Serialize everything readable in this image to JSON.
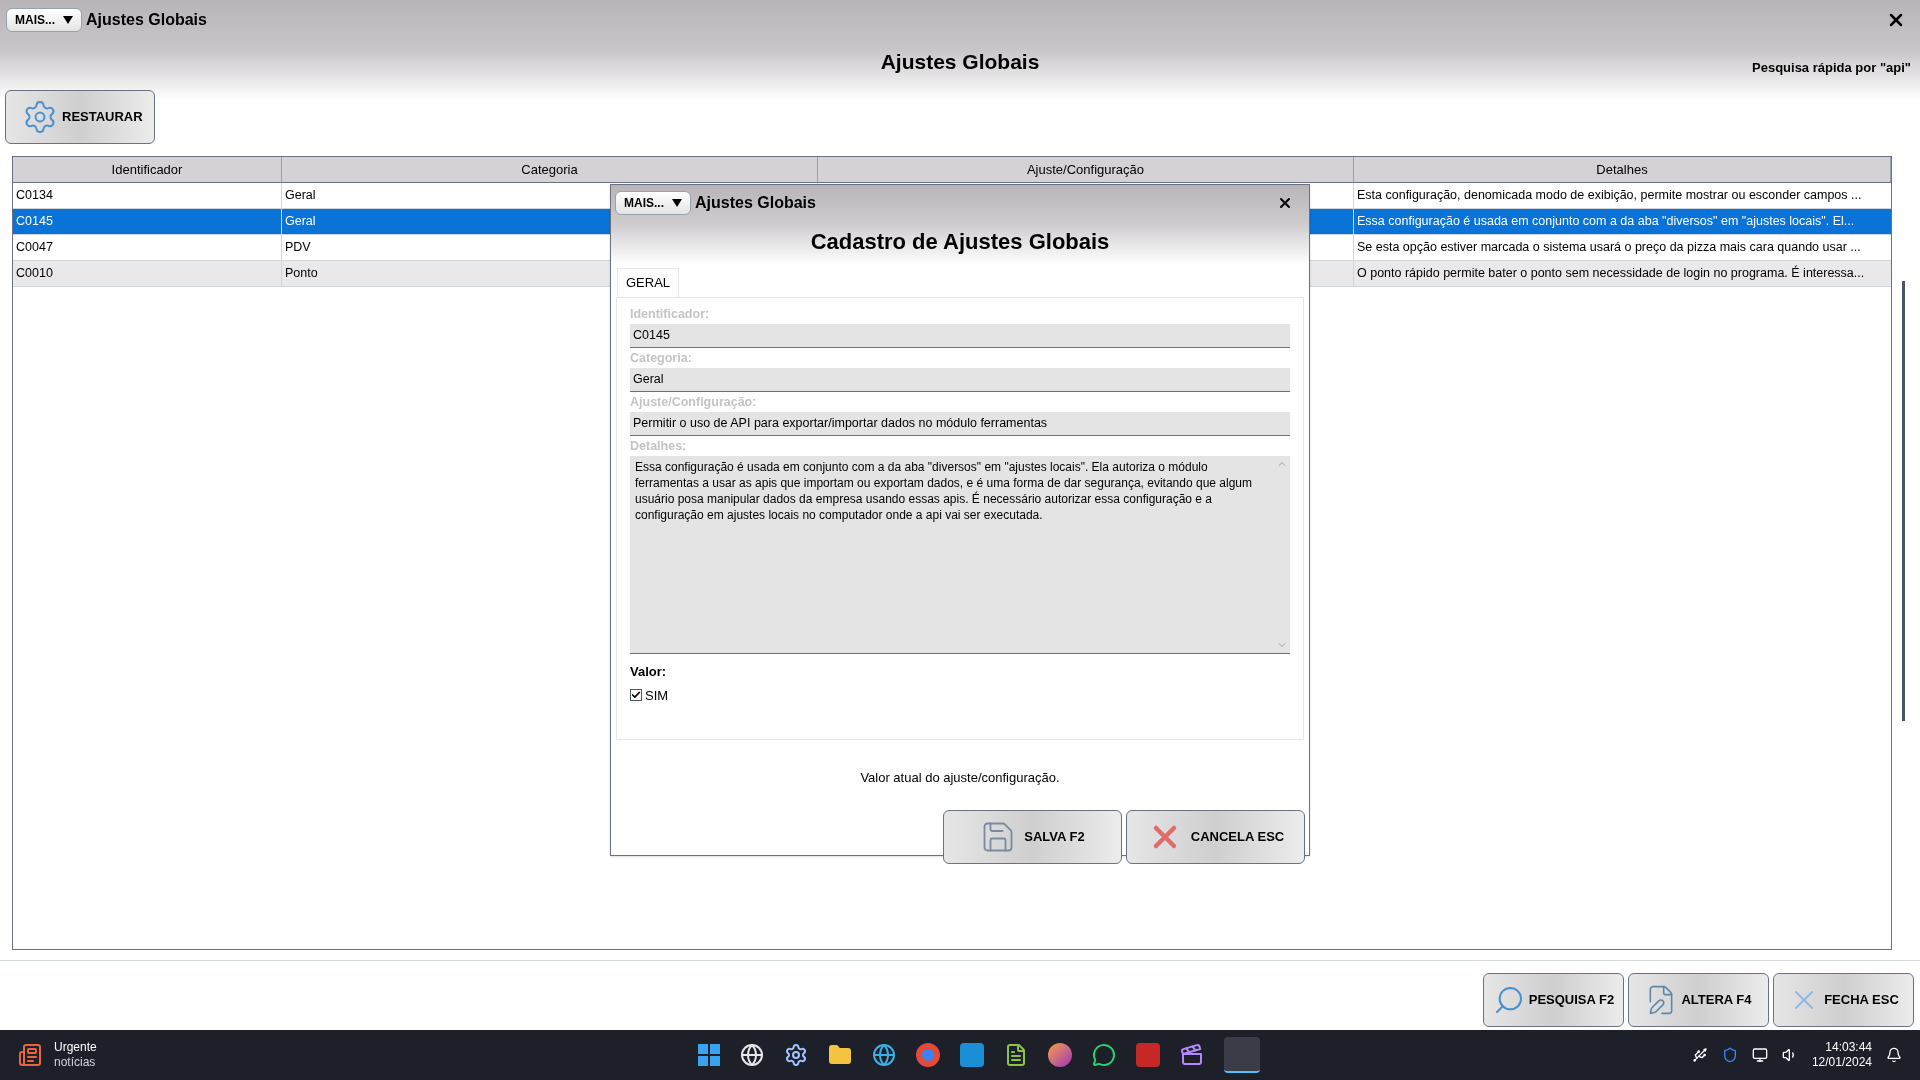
{
  "window": {
    "menu_button": "MAIS...",
    "title": "Ajustes Globais",
    "heading": "Ajustes Globais",
    "quick_search": "Pesquisa rápida por \"api\""
  },
  "toolbar": {
    "restore_button": "RESTAURAR"
  },
  "table": {
    "columns": [
      "Identificador",
      "Categoria",
      "Ajuste/Configuração",
      "Detalhes"
    ],
    "rows": [
      {
        "identificador": "C0134",
        "categoria": "Geral",
        "detalhes": "Esta configuração, denomicada modo de exibição, permite mostrar ou esconder campos ...",
        "selected": false
      },
      {
        "identificador": "C0145",
        "categoria": "Geral",
        "detalhes": "Essa configuração é usada em conjunto com a da aba \"diversos\" em \"ajustes locais\". El...",
        "selected": true
      },
      {
        "identificador": "C0047",
        "categoria": "PDV",
        "detalhes": "Se esta opção estiver marcada o sistema usará o preço da pizza mais cara quando usar ...",
        "selected": false
      },
      {
        "identificador": "C0010",
        "categoria": "Ponto",
        "detalhes": "O ponto rápido permite bater o ponto sem necessidade de login no programa. É interessa...",
        "selected": false
      }
    ]
  },
  "dialog": {
    "menu_button": "MAIS...",
    "title": "Ajustes Globais",
    "heading": "Cadastro de Ajustes Globais",
    "tabs": [
      {
        "label": "GERAL",
        "selected": true
      }
    ],
    "fields": [
      {
        "kind": "input",
        "label": "Identificador:",
        "value": "C0145"
      },
      {
        "kind": "input",
        "label": "Categoria:",
        "value": "Geral"
      },
      {
        "kind": "input",
        "label": "Ajuste/Configuração:",
        "value": "Permitir o uso de API para exportar/importar dados no módulo ferramentas"
      },
      {
        "kind": "textarea",
        "label": "Detalhes:",
        "value": "Essa configuração é usada em conjunto com a da aba \"diversos\" em \"ajustes locais\". Ela autoriza o módulo ferramentas a usar as apis que importam ou exportam dados, e é uma forma de dar segurança, evitando que algum usuário posa manipular dados da empresa usando essas apis. É necessário autorizar essa configuração e a configuração em ajustes locais no computador onde a api vai ser executada."
      }
    ],
    "value_label": "Valor:",
    "checkbox": {
      "label": "SIM",
      "checked": true
    },
    "hint": "Valor atual do ajuste/configuração.",
    "buttons": [
      {
        "kind": "save",
        "label": "SALVA F2"
      },
      {
        "kind": "cancel",
        "label": "CANCELA ESC"
      }
    ]
  },
  "bottom_buttons": [
    {
      "kind": "search",
      "label": "PESQUISA F2"
    },
    {
      "kind": "edit",
      "label": "ALTERA F4"
    },
    {
      "kind": "close",
      "label": "FECHA ESC"
    }
  ],
  "taskbar": {
    "news_title": "Urgente",
    "news_subtitle": "notícias",
    "time": "14:03:44",
    "date": "12/01/2024"
  }
}
